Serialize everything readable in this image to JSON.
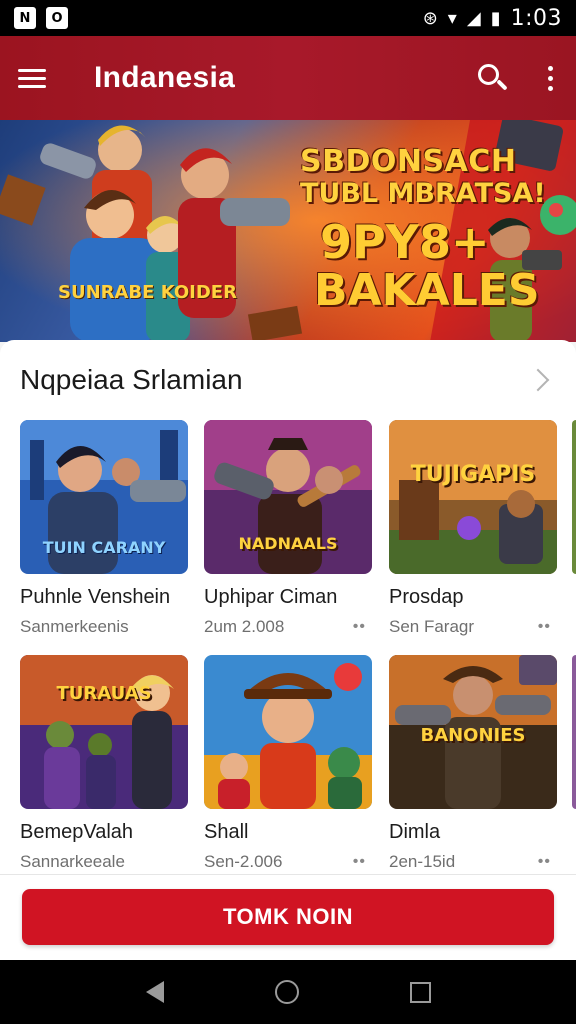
{
  "status_bar": {
    "left_icons": [
      "N",
      "O"
    ],
    "right_glyphs": [
      "⊛",
      "▾",
      "◢",
      "▮"
    ],
    "time": "1:03"
  },
  "app_bar": {
    "title": "Indanesia",
    "menu_icon": "hamburger-menu-icon",
    "search_icon": "search-icon",
    "more_icon": "more-vert-icon",
    "color": "#a8192a"
  },
  "banner": {
    "line1": "SBDONSACH",
    "line2": "TUBL MBRATSA!",
    "line3": "9PY8+",
    "line4": "BAKALES",
    "shirt_text": "SUNRABE KOIDER"
  },
  "section": {
    "title": "Nqpeiaa Srlamian",
    "more_icon": "chevron-right-icon"
  },
  "cards": [
    {
      "title": "Puhnle Venshein",
      "meta": "Sanmerkeenis",
      "art_text": "TUIN CARANY",
      "dots": "••"
    },
    {
      "title": "Uphipar Ciman",
      "meta": "2um 2.008",
      "art_text": "NADNAALS",
      "dots": "••"
    },
    {
      "title": "Prosdap",
      "meta": "Sen Faragr",
      "art_text": "TUJIGAPIS",
      "dots": "••"
    },
    {
      "title": "BemepValah",
      "meta": "Sannarkeeale",
      "art_text": "TURAUAS",
      "dots": "••"
    },
    {
      "title": "Shall",
      "meta": "Sen-2.006",
      "art_text": "",
      "dots": "••"
    },
    {
      "title": "Dimla",
      "meta": "2en-15id",
      "art_text": "BANONIES",
      "dots": "••"
    }
  ],
  "cta": {
    "label": "TOMK NOIN",
    "color": "#d01423"
  },
  "nav_bar": {
    "back": "back-icon",
    "home": "home-icon",
    "recents": "recents-icon"
  }
}
